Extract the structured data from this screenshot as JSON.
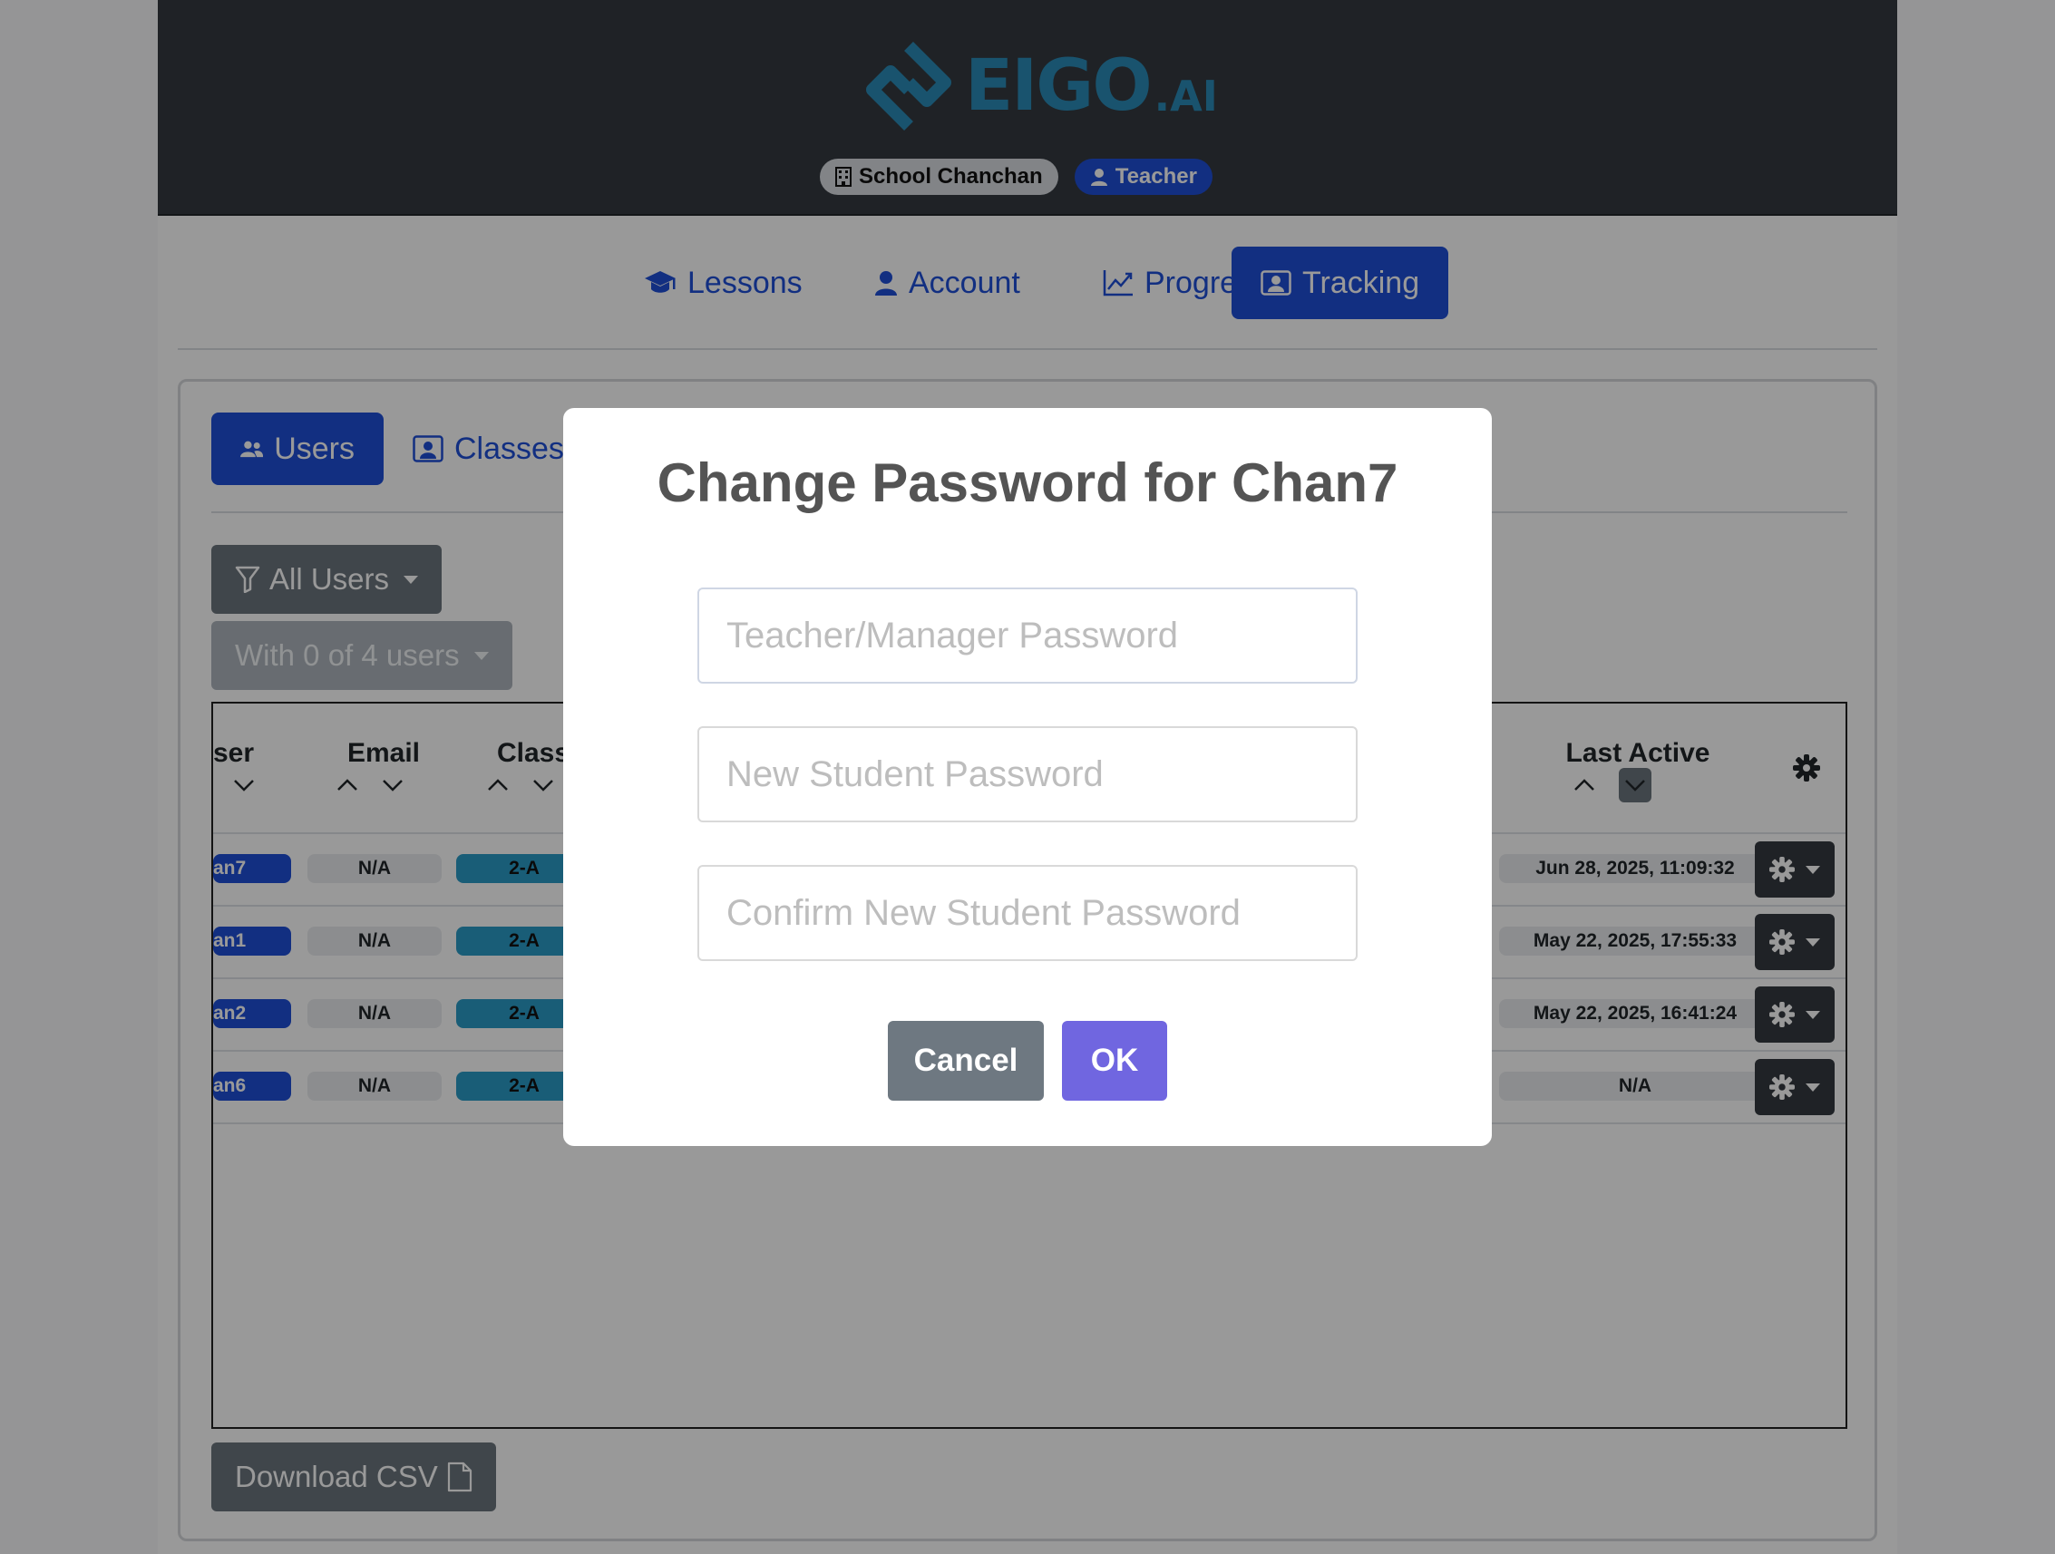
{
  "brand": {
    "logo_text": "EIGO",
    "logo_suffix": ".AI",
    "color": "#2a8bb7"
  },
  "header": {
    "school_badge": "School Chanchan",
    "role_badge": "Teacher"
  },
  "main_nav": [
    {
      "label": "Lessons",
      "icon": "graduation-cap-icon",
      "active": false
    },
    {
      "label": "Account",
      "icon": "user-icon",
      "active": false
    },
    {
      "label": "Progress",
      "icon": "chart-line-icon",
      "active": false
    },
    {
      "label": "Tracking",
      "icon": "id-card-icon",
      "active": true
    }
  ],
  "sub_nav": [
    {
      "label": "Users",
      "icon": "users-icon",
      "active": true
    },
    {
      "label": "Classes",
      "icon": "id-card-icon",
      "active": false
    }
  ],
  "filters": {
    "user_filter": "All Users",
    "bulk_action": "With 0 of 4 users"
  },
  "table": {
    "columns": [
      "ser",
      "Email",
      "Class",
      "Last Active"
    ],
    "rows": [
      {
        "user": "an7",
        "email": "N/A",
        "class": "2-A",
        "last_active": "Jun 28, 2025, 11:09:32"
      },
      {
        "user": "an1",
        "email": "N/A",
        "class": "2-A",
        "last_active": "May 22, 2025, 17:55:33"
      },
      {
        "user": "an2",
        "email": "N/A",
        "class": "2-A",
        "last_active": "May 22, 2025, 16:41:24"
      },
      {
        "user": "an6",
        "email": "N/A",
        "class": "2-A",
        "last_active": "N/A"
      }
    ]
  },
  "download_button": "Download CSV",
  "modal": {
    "title": "Change Password for Chan7",
    "teacher_password_placeholder": "Teacher/Manager Password",
    "new_password_placeholder": "New Student Password",
    "confirm_password_placeholder": "Confirm New Student Password",
    "cancel_label": "Cancel",
    "ok_label": "OK",
    "ok_color": "#7066e0",
    "cancel_color": "#6e7881"
  }
}
